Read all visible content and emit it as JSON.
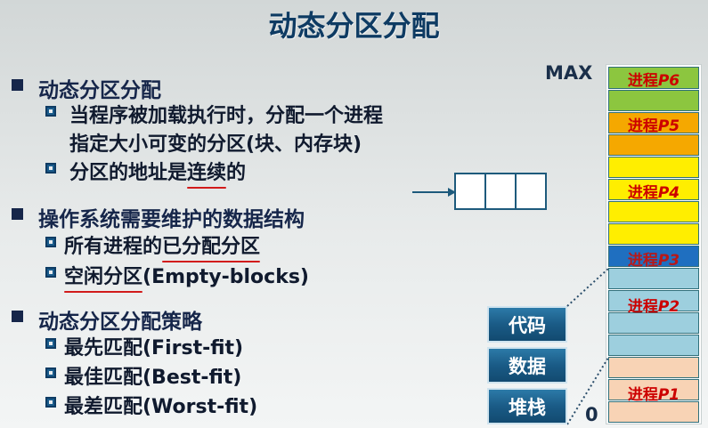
{
  "title": "动态分区分配",
  "bullets": [
    {
      "text": "动态分区分配"
    },
    {
      "text": "当程序被加载执行时，分配一个进程"
    },
    {
      "text": "指定大小可变的分区(块、内存块)"
    },
    {
      "pre": "分区的地址是",
      "emph": "连续",
      "post": "的"
    },
    {
      "text": "操作系统需要维护的数据结构"
    },
    {
      "pre": "所有进程的",
      "emph": "已分配分区",
      "post": ""
    },
    {
      "pre": "",
      "emph": "空闲分区",
      "post": "(Empty-blocks)"
    },
    {
      "text": "动态分区分配策略"
    },
    {
      "text": "最先匹配(First-fit)"
    },
    {
      "text": "最佳匹配(Best-fit)"
    },
    {
      "text": "最差匹配(Worst-fit)"
    }
  ],
  "memory": {
    "max_label": "MAX",
    "zero_label": "0",
    "process_prefix": "进程",
    "labels": [
      "P6",
      "P5",
      "P4",
      "P3",
      "P2",
      "P1"
    ],
    "colors": {
      "green": "#8cc63f",
      "orange": "#f5a800",
      "yellow": "#ffee00",
      "blue": "#1f6fc0",
      "lightblue": "#9dcfde",
      "peach": "#f8d3b5"
    }
  },
  "stack_boxes": [
    "代码",
    "数据",
    "堆栈"
  ]
}
